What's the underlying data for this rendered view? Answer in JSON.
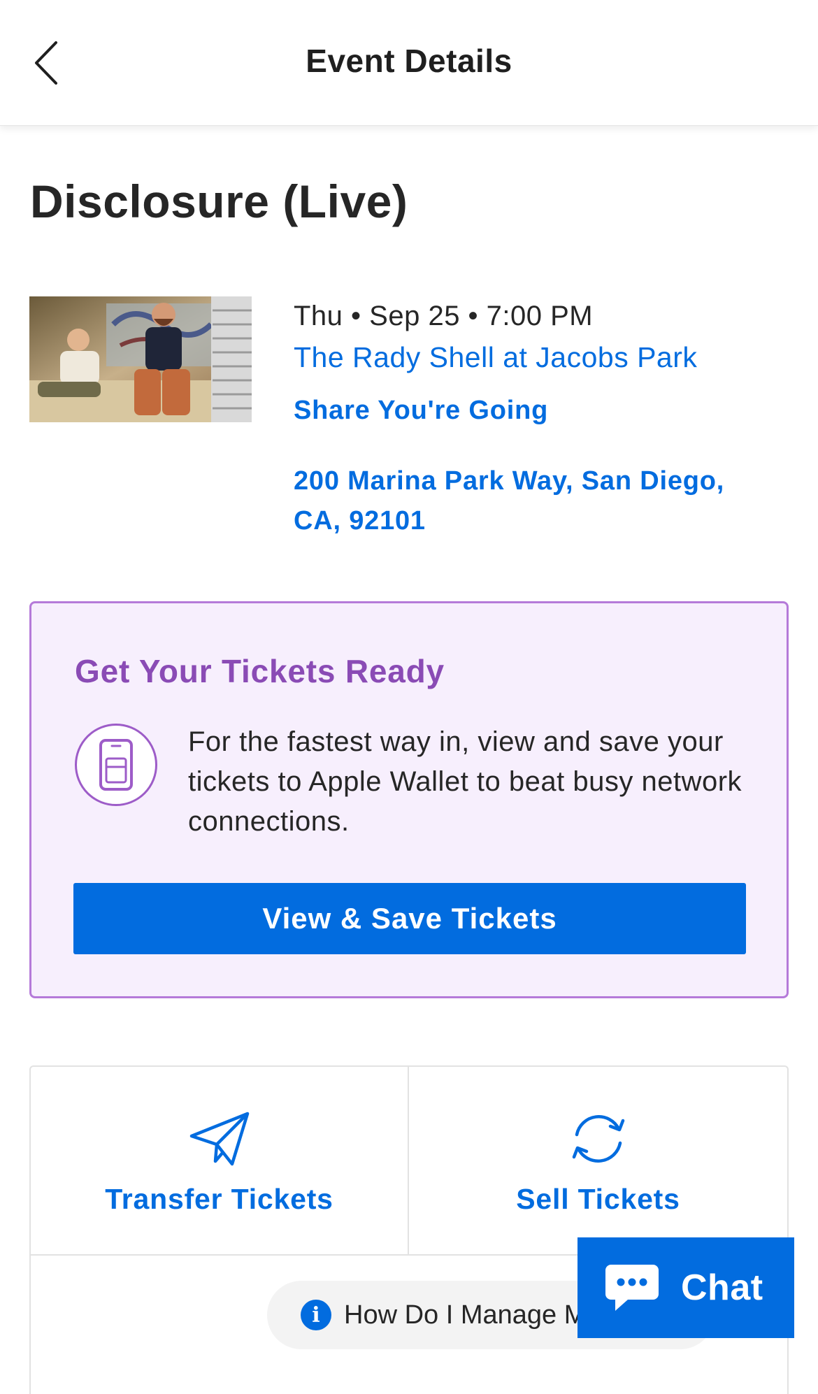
{
  "header": {
    "title": "Event Details"
  },
  "event": {
    "title": "Disclosure (Live)",
    "date": "Thu • Sep 25 • 7:00 PM",
    "venue": "The Rady Shell at Jacobs Park",
    "share_label": "Share You're Going",
    "address": "200 Marina Park Way, San Diego, CA, 92101"
  },
  "ready_card": {
    "title": "Get Your Tickets Ready",
    "text": "For the fastest way in, view and save your tickets to Apple Wallet to beat busy network connections.",
    "button_label": "View & Save Tickets"
  },
  "actions": {
    "transfer_label": "Transfer Tickets",
    "sell_label": "Sell Tickets",
    "manage_label": "How Do I Manage My Tickets?"
  },
  "chat": {
    "label": "Chat"
  },
  "colors": {
    "brand_blue": "#026cdf",
    "card_purple": "#8a4bb5",
    "card_bg": "#f7effd"
  }
}
